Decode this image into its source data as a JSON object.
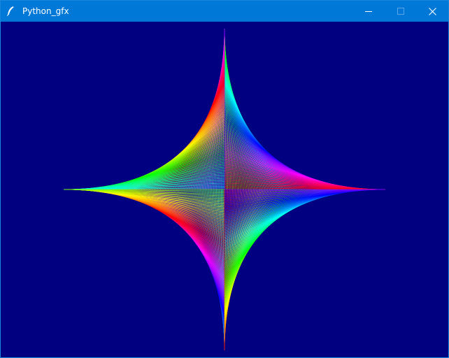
{
  "window": {
    "title": "Python_gfx",
    "app_icon": "feather-icon",
    "controls": {
      "minimize_icon": "minimize-icon",
      "maximize_icon": "maximize-icon",
      "close_icon": "close-icon"
    },
    "colors": {
      "titlebar": "#0078d7",
      "canvas_background": "#000080"
    }
  },
  "graphic": {
    "shape": "astroid string art",
    "line_count": 100,
    "color_scheme": "rainbow"
  }
}
